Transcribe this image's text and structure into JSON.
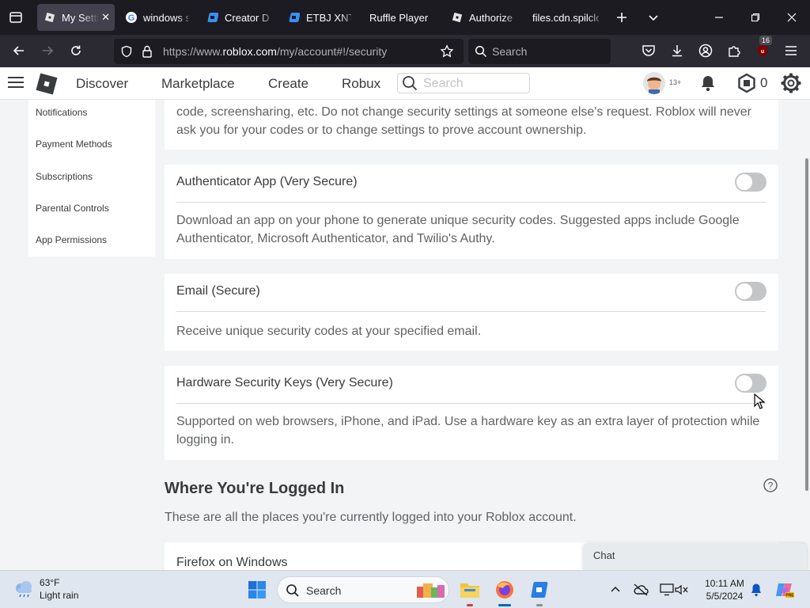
{
  "browser": {
    "tabs": [
      {
        "title": "My Setti",
        "active": true
      },
      {
        "title": "windows s",
        "active": false
      },
      {
        "title": "Creator Da",
        "active": false
      },
      {
        "title": "ETBJ XNT /",
        "active": false
      },
      {
        "title": "Ruffle Player",
        "active": false
      },
      {
        "title": "Authorize a",
        "active": false
      },
      {
        "title": "files.cdn.spilclo",
        "active": false
      }
    ],
    "url_prefix": "https://www.",
    "url_host": "roblox.com",
    "url_path": "/my/account#!/security",
    "search_placeholder": "Search",
    "badge_count": "16"
  },
  "header": {
    "nav": [
      "Discover",
      "Marketplace",
      "Create",
      "Robux"
    ],
    "search_placeholder": "Search",
    "age_badge": "13+",
    "robux_balance": "0"
  },
  "sidebar": {
    "items": [
      "Notifications",
      "Payment Methods",
      "Subscriptions",
      "Parental Controls",
      "App Permissions"
    ]
  },
  "security": {
    "intro_line1": "code, screensharing, etc. Do not change security settings at someone else's request. Roblox will never",
    "intro_line2": "ask you for your codes or to change settings to prove account ownership.",
    "methods": [
      {
        "title": "Authenticator App (Very Secure)",
        "desc": "Download an app on your phone to generate unique security codes. Suggested apps include Google Authenticator, Microsoft Authenticator, and Twilio's Authy.",
        "enabled": false
      },
      {
        "title": "Email (Secure)",
        "desc": "Receive unique security codes at your specified email.",
        "enabled": false
      },
      {
        "title": "Hardware Security Keys (Very Secure)",
        "desc": "Supported on web browsers, iPhone, and iPad. Use a hardware key as an extra layer of protection while logging in.",
        "enabled": false
      }
    ]
  },
  "logged_in": {
    "title": "Where You're Logged In",
    "subtitle": "These are all the places you're currently logged into your Roblox account.",
    "first_session": "Firefox on Windows"
  },
  "chat": {
    "label": "Chat"
  },
  "taskbar": {
    "weather_temp": "63°F",
    "weather_desc": "Light rain",
    "search_label": "Search",
    "time": "10:11 AM",
    "date": "5/5/2024"
  },
  "colors": {
    "browser_dark": "#1c1b22",
    "toolbar": "#2b2a33",
    "page_bg": "#f2f4f5",
    "toggle_off": "#c3c5c7",
    "taskbar": "#dfe6ef"
  }
}
